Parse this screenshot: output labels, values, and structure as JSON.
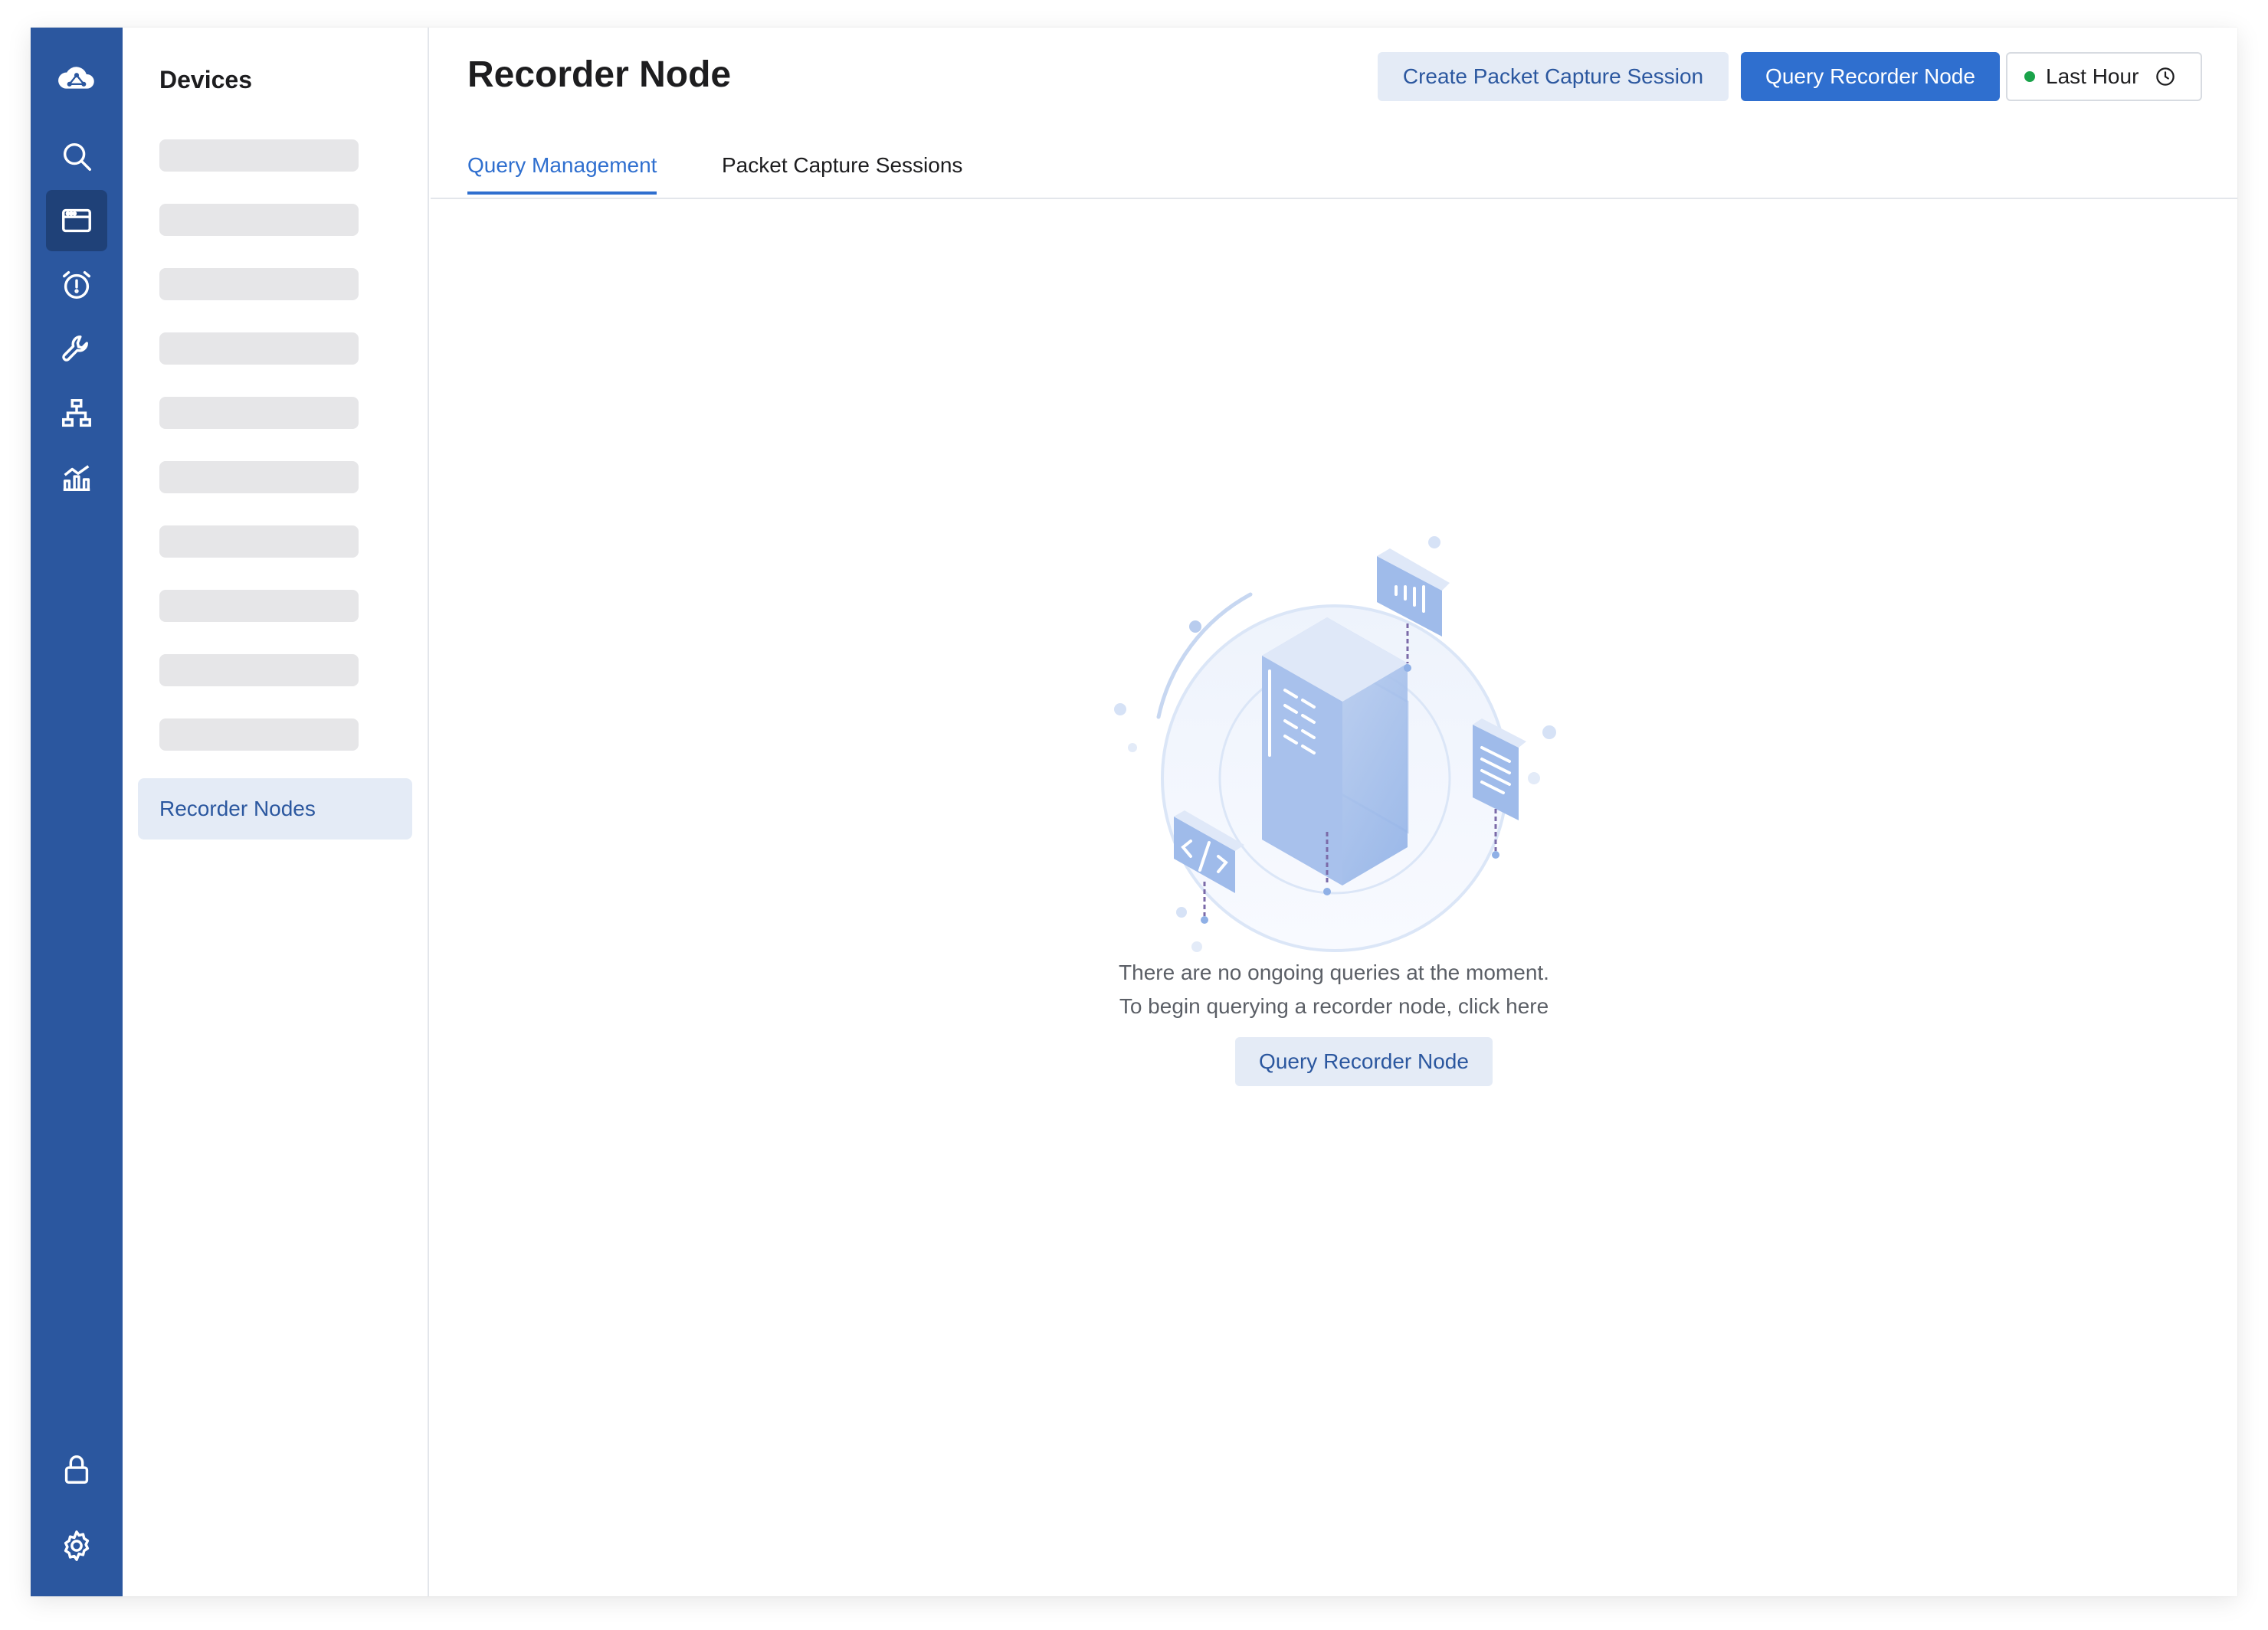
{
  "rail": {
    "items": [
      {
        "name": "cloud-logo-icon"
      },
      {
        "name": "search-icon"
      },
      {
        "name": "devices-icon",
        "active": true
      },
      {
        "name": "alarm-icon"
      },
      {
        "name": "wrench-icon"
      },
      {
        "name": "network-topology-icon"
      },
      {
        "name": "analytics-icon"
      },
      {
        "name": "lock-icon"
      },
      {
        "name": "settings-gear-icon"
      }
    ]
  },
  "subnav": {
    "title": "Devices",
    "skeleton_count": 10,
    "selected_item": "Recorder Nodes"
  },
  "header": {
    "title": "Recorder Node",
    "create_session_label": "Create Packet Capture Session",
    "query_label": "Query Recorder Node",
    "time_range_label": "Last Hour",
    "time_status_color": "#1aa34a"
  },
  "tabs": [
    {
      "label": "Query Management",
      "active": true
    },
    {
      "label": "Packet Capture Sessions",
      "active": false
    }
  ],
  "empty_state": {
    "line1": "There are no ongoing queries at the moment.",
    "line2": "To begin querying a recorder node, click here",
    "button_label": "Query Recorder Node"
  },
  "colors": {
    "rail_bg": "#2b579f",
    "accent": "#2f6fcf",
    "accent_soft": "#e4ebf6"
  }
}
